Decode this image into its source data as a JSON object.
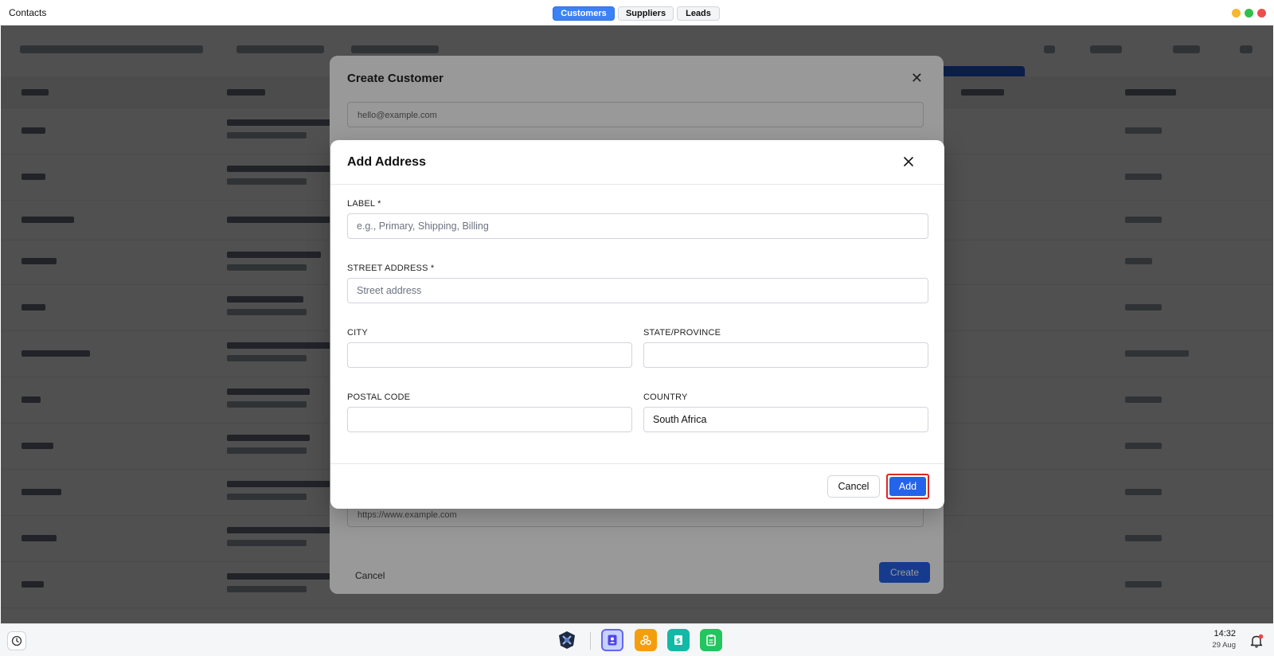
{
  "window": {
    "title": "Contacts",
    "tabs": [
      {
        "label": "Customers",
        "active": true
      },
      {
        "label": "Suppliers",
        "active": false
      },
      {
        "label": "Leads",
        "active": false
      }
    ],
    "controls": {
      "minimize_color": "#f5b82e",
      "maximize_color": "#2fbf4a",
      "close_color": "#ee4d4d"
    }
  },
  "background_modal": {
    "title": "Create Customer",
    "email_placeholder": "hello@example.com",
    "website_placeholder": "https://www.example.com",
    "cancel_label": "Cancel",
    "create_label": "Create"
  },
  "address_dialog": {
    "title": "Add Address",
    "fields": {
      "label": {
        "label": "LABEL *",
        "placeholder": "e.g., Primary, Shipping, Billing",
        "value": ""
      },
      "street": {
        "label": "STREET ADDRESS *",
        "placeholder": "Street address",
        "value": ""
      },
      "city": {
        "label": "CITY",
        "value": ""
      },
      "state": {
        "label": "STATE/PROVINCE",
        "value": ""
      },
      "postal": {
        "label": "POSTAL CODE",
        "value": ""
      },
      "country": {
        "label": "COUNTRY",
        "value": "South Africa"
      }
    },
    "cancel_label": "Cancel",
    "add_label": "Add",
    "accent_color": "#2563eb",
    "highlight_color": "#dc2626"
  },
  "taskbar": {
    "apps": [
      "clock-icon",
      "app-logo-icon",
      "contacts-icon",
      "integrations-icon",
      "invoices-icon",
      "clipboard-icon"
    ],
    "time": "14:32",
    "date": "29 Aug"
  }
}
